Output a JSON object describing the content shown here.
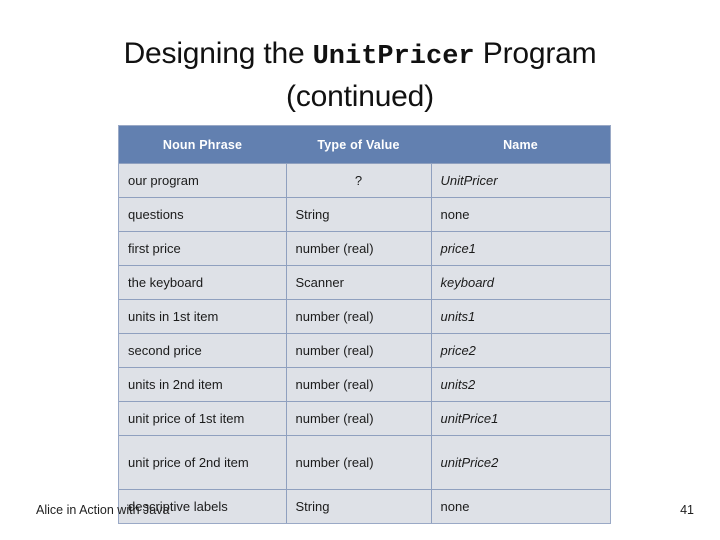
{
  "slide": {
    "title_part1": "Designing the ",
    "title_mono": "UnitPricer",
    "title_part2": " Program",
    "title_line2": "(continued)"
  },
  "table": {
    "headers": [
      "Noun Phrase",
      "Type of Value",
      "Name"
    ],
    "rows": [
      {
        "noun_phrase": "our program",
        "type_of_value": "?",
        "name": "UnitPricer"
      },
      {
        "noun_phrase": "questions",
        "type_of_value": "String",
        "name": "none"
      },
      {
        "noun_phrase": "first price",
        "type_of_value": "number (real)",
        "name": "price1"
      },
      {
        "noun_phrase": "the keyboard",
        "type_of_value": "Scanner",
        "name": "keyboard"
      },
      {
        "noun_phrase": "units in 1st item",
        "type_of_value": "number (real)",
        "name": "units1"
      },
      {
        "noun_phrase": "second price",
        "type_of_value": "number (real)",
        "name": "price2"
      },
      {
        "noun_phrase": "units in 2nd item",
        "type_of_value": "number (real)",
        "name": "units2"
      },
      {
        "noun_phrase": "unit price of 1st item",
        "type_of_value": "number (real)",
        "name": "unitPrice1"
      },
      {
        "noun_phrase": "unit price of 2nd item",
        "type_of_value": "number (real)",
        "name": "unitPrice2"
      },
      {
        "noun_phrase": "descriptive labels",
        "type_of_value": "String",
        "name": "none"
      }
    ]
  },
  "footer": {
    "source": "Alice in Action with Java",
    "page_number": "41"
  },
  "colors": {
    "header_blue": "#6280b0",
    "cell_gray": "#dee1e7",
    "cell_border": "#8fa0bf",
    "text": "#1b1b1b"
  }
}
